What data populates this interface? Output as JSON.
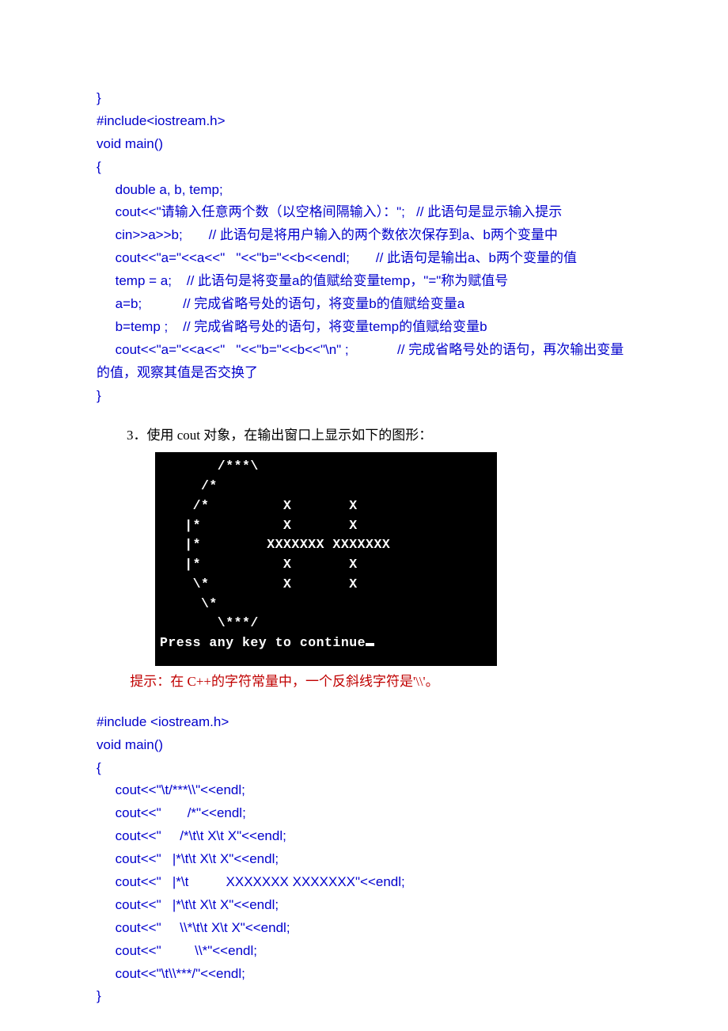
{
  "code1": "}\n#include<iostream.h>\nvoid main()\n{\n     double a, b, temp;\n     cout<<\"请输入任意两个数（以空格间隔输入）：\";   // 此语句是显示输入提示\n     cin>>a>>b;       // 此语句是将用户输入的两个数依次保存到a、b两个变量中\n     cout<<\"a=\"<<a<<\"   \"<<\"b=\"<<b<<endl;       // 此语句是输出a、b两个变量的值\n     temp = a;    // 此语句是将变量a的值赋给变量temp，\"=\"称为赋值号\n     a=b;           // 完成省略号处的语句，将变量b的值赋给变量a\n     b=temp ;    // 完成省略号处的语句，将变量temp的值赋给变量b\n     cout<<\"a=\"<<a<<\"   \"<<\"b=\"<<b<<\"\\n\" ;             // 完成省略号处的语句，再次输出变量的值，观察其值是否交换了\n}",
  "q3": "3．使用 cout 对象，在输出窗口上显示如下的图形：",
  "console": "       /***\\\n     /*\n    /*         X       X\n   |*          X       X\n   |*        XXXXXXX XXXXXXX\n   |*          X       X\n    \\*         X       X\n     \\*\n       \\***/\nPress any key to continue",
  "hint": " 提示：在 C++的字符常量中，一个反斜线字符是'\\\\'。",
  "code2": "#include <iostream.h>\nvoid main()\n{\n     cout<<\"\\t/***\\\\\"<<endl;\n     cout<<\"       /*\"<<endl;\n     cout<<\"     /*\\t\\t X\\t X\"<<endl;\n     cout<<\"   |*\\t\\t X\\t X\"<<endl;\n     cout<<\"   |*\\t          XXXXXXX XXXXXXX\"<<endl;\n     cout<<\"   |*\\t\\t X\\t X\"<<endl;\n     cout<<\"     \\\\*\\t\\t X\\t X\"<<endl;\n     cout<<\"         \\\\*\"<<endl;\n     cout<<\"\\t\\\\***/\"<<endl;\n}"
}
